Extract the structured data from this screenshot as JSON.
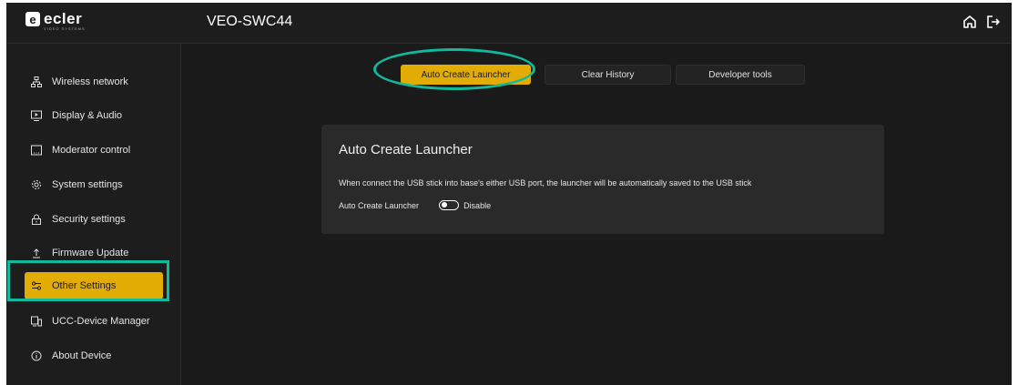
{
  "app": {
    "logo_text": "ecler",
    "logo_subtext": "VIDEO SYSTEMS",
    "device_name": "VEO-SWC44"
  },
  "header_icons": [
    "home-icon",
    "logout-icon"
  ],
  "sidebar": {
    "items": [
      {
        "label": "Wireless network",
        "icon": "network-icon",
        "active": false
      },
      {
        "label": "Display & Audio",
        "icon": "display-icon",
        "active": false
      },
      {
        "label": "Moderator control",
        "icon": "moderator-icon",
        "active": false
      },
      {
        "label": "System settings",
        "icon": "gear-icon",
        "active": false
      },
      {
        "label": "Security settings",
        "icon": "lock-icon",
        "active": false
      },
      {
        "label": "Firmware Update",
        "icon": "upload-icon",
        "active": false
      },
      {
        "label": "Other Settings",
        "icon": "sliders-icon",
        "active": true
      },
      {
        "label": "UCC-Device Manager",
        "icon": "device-manager-icon",
        "active": false
      },
      {
        "label": "About Device",
        "icon": "info-icon",
        "active": false
      }
    ]
  },
  "tabs": [
    {
      "label": "Auto Create Launcher",
      "active": true
    },
    {
      "label": "Clear History",
      "active": false
    },
    {
      "label": "Developer tools",
      "active": false
    }
  ],
  "panel": {
    "title": "Auto Create Launcher",
    "description": "When connect the USB stick into base's either USB port, the launcher will be automatically saved to the USB stick",
    "setting_label": "Auto Create Launcher",
    "toggle_state": "Disable"
  },
  "colors": {
    "accent": "#e2ac05",
    "annotation": "#12b99c",
    "background": "#1a1a1a",
    "panel": "#2a2a2a"
  }
}
